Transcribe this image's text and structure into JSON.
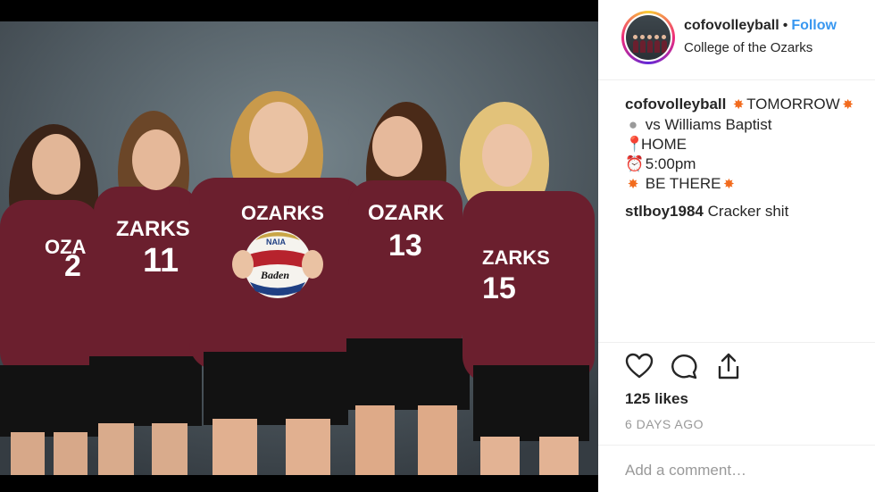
{
  "post": {
    "username": "cofovolleyball",
    "separator": "•",
    "follow_label": "Follow",
    "location": "College of the Ozarks"
  },
  "caption": {
    "author": "cofovolleyball",
    "line1_text": "TOMORROW",
    "line2_text": "vs Williams Baptist",
    "line3_text": "HOME",
    "line4_text": "5:00pm",
    "line5_text": "BE THERE"
  },
  "comment": {
    "author": "stlboy1984",
    "text": "Cracker shit"
  },
  "stats": {
    "likes": "125 likes",
    "time": "6 DAYS AGO"
  },
  "composer": {
    "placeholder": "Add a comment…"
  },
  "photo": {
    "jersey_text": "OZARKS",
    "numbers": [
      "2",
      "11",
      "",
      "13",
      "15"
    ],
    "ball_text": "NAIA",
    "ball_brand": "Baden"
  },
  "icons": {
    "emoji_boom": "collision-emoji-icon",
    "emoji_ball": "volleyball-emoji-icon",
    "emoji_pin": "round-pushpin-emoji-icon",
    "emoji_clock": "alarm-clock-emoji-icon"
  },
  "colors": {
    "follow": "#3897f0",
    "jersey": "#6b1f2e",
    "muted": "#999999"
  }
}
